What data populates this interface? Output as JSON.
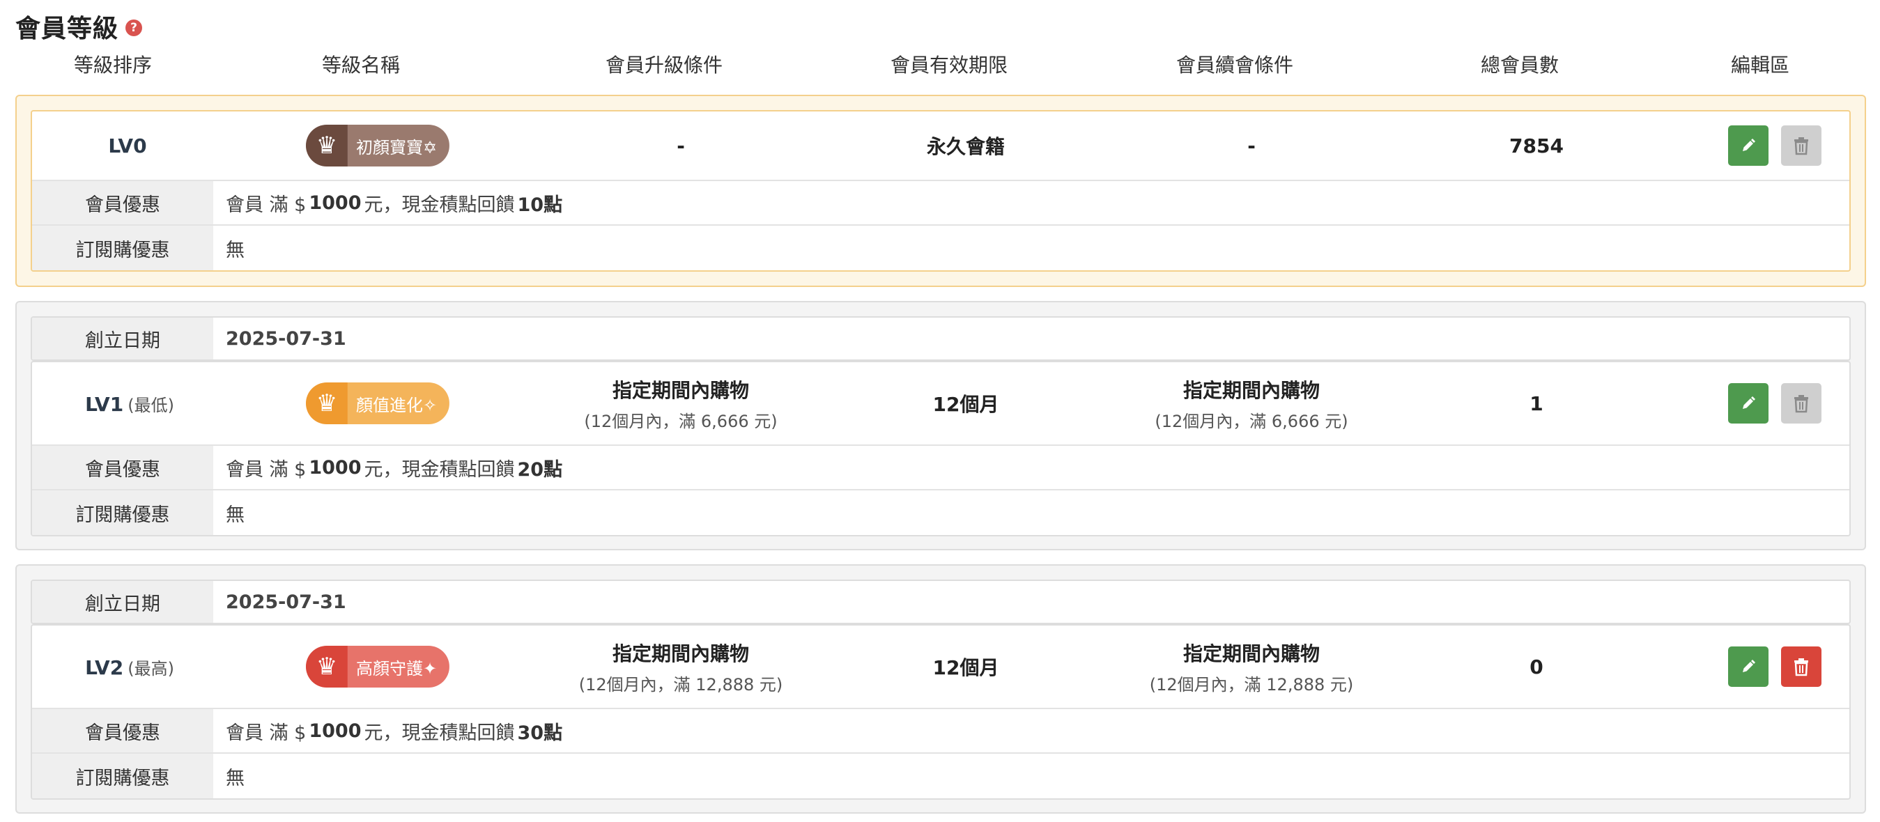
{
  "page": {
    "title": "會員等級",
    "help_icon": "?"
  },
  "columns": [
    "等級排序",
    "等級名稱",
    "會員升級條件",
    "會員有效期限",
    "會員續會條件",
    "總會員數",
    "編輯區"
  ],
  "labels": {
    "created_date": "創立日期",
    "member_benefit": "會員優惠",
    "subscription_benefit": "訂閱購優惠"
  },
  "icons": {
    "crown": "crown-icon",
    "edit": "pencil-icon",
    "delete": "trash-icon",
    "help": "question-icon"
  },
  "levels": [
    {
      "level": "LV0",
      "level_note": "",
      "name": "初顏寶寶✡",
      "badge_colors": {
        "crown": "#6b4a3e",
        "text": "#9a7a6e"
      },
      "upgrade": {
        "main": "-",
        "sub": ""
      },
      "validity": "永久會籍",
      "renew": {
        "main": "-",
        "sub": ""
      },
      "members": "7854",
      "created": "",
      "benefit": {
        "prefix": "會員 滿 $",
        "amount": "1000",
        "middle": "元，現金積點回饋",
        "points": "10點"
      },
      "subscription": "無",
      "delete_enabled": false
    },
    {
      "level": "LV1",
      "level_note": "(最低)",
      "name": "顏值進化✧",
      "badge_colors": {
        "crown": "#ef9a2f",
        "text": "#f4b45a"
      },
      "upgrade": {
        "main": "指定期間內購物",
        "sub": "(12個月內，滿 6,666 元)"
      },
      "validity": "12個月",
      "renew": {
        "main": "指定期間內購物",
        "sub": "(12個月內，滿 6,666 元)"
      },
      "members": "1",
      "created": "2025-07-31",
      "benefit": {
        "prefix": "會員 滿 $",
        "amount": "1000",
        "middle": "元，現金積點回饋",
        "points": "20點"
      },
      "subscription": "無",
      "delete_enabled": false
    },
    {
      "level": "LV2",
      "level_note": "(最高)",
      "name": "高顏守護✦",
      "badge_colors": {
        "crown": "#d9453a",
        "text": "#e7736a"
      },
      "upgrade": {
        "main": "指定期間內購物",
        "sub": "(12個月內，滿 12,888 元)"
      },
      "validity": "12個月",
      "renew": {
        "main": "指定期間內購物",
        "sub": "(12個月內，滿 12,888 元)"
      },
      "members": "0",
      "created": "2025-07-31",
      "benefit": {
        "prefix": "會員 滿 $",
        "amount": "1000",
        "middle": "元，現金積點回饋",
        "points": "30點"
      },
      "subscription": "無",
      "delete_enabled": true
    }
  ]
}
